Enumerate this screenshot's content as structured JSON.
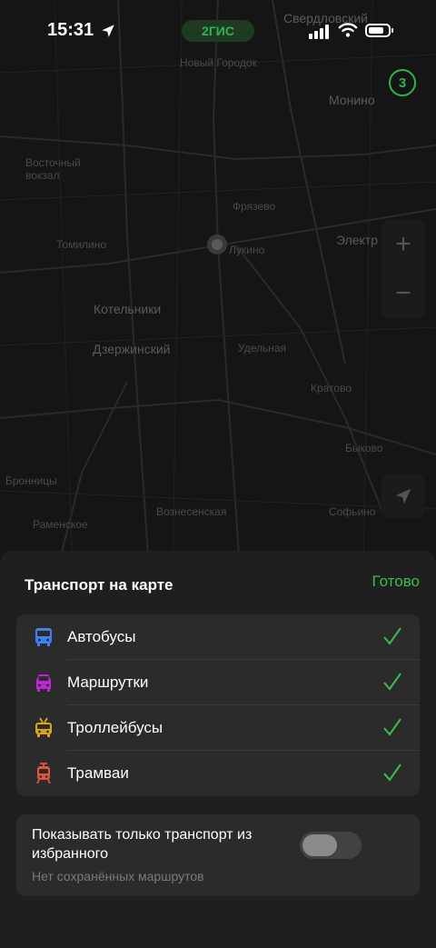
{
  "status_bar": {
    "time": "15:31",
    "brand": "2ГИС",
    "battery_level": 0.6
  },
  "map": {
    "traffic_score": "3",
    "labels": [
      "Свердловский",
      "Новый Городок",
      "Монино",
      "Восточный вокзал",
      "Фрязево",
      "Электр",
      "Лукино",
      "Томилино",
      "Котельники",
      "Дзержинский",
      "Удельная",
      "Кратово",
      "Быково",
      "Раменское",
      "Бронницы",
      "Вознесенская",
      "Софьино"
    ]
  },
  "sheet": {
    "title": "Транспорт на карте",
    "done_label": "Готово",
    "items": [
      {
        "label": "Автобусы",
        "checked": true,
        "color": "#3b82f6",
        "icon": "bus-icon"
      },
      {
        "label": "Маршрутки",
        "checked": true,
        "color": "#c026d3",
        "icon": "minibus-icon"
      },
      {
        "label": "Троллейбусы",
        "checked": true,
        "color": "#d9a514",
        "icon": "trolleybus-icon"
      },
      {
        "label": "Трамваи",
        "checked": true,
        "color": "#e0533a",
        "icon": "tram-icon"
      }
    ],
    "favorites_only": {
      "label": "Показывать только транспорт из избранного",
      "sublabel": "Нет сохранённых маршрутов",
      "enabled": false
    }
  },
  "colors": {
    "accent": "#3dbb4d",
    "check": "#3dbb4d",
    "sheet_bg": "#1f1f1f",
    "card_bg": "#2b2b2b"
  }
}
